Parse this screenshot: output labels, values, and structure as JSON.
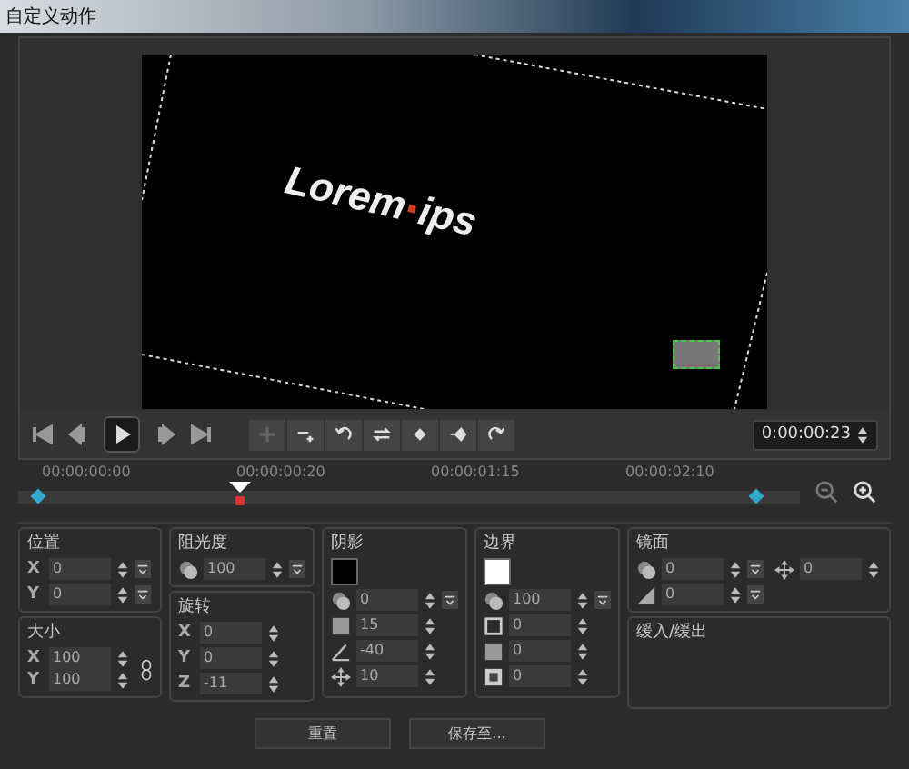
{
  "window": {
    "title": "自定义动作"
  },
  "preview": {
    "word_1": "Lorem",
    "word_2": "ips"
  },
  "transport": {
    "time": "0:00:00:23"
  },
  "timeline": {
    "labels": [
      "00:00:00:00",
      "00:00:00:20",
      "00:00:01:15",
      "00:00:02:10"
    ],
    "playhead": {
      "level": 0.29
    }
  },
  "groups": [
    {
      "title": "位置",
      "fields": [
        {
          "label": "X",
          "value": "0",
          "menu": true
        },
        {
          "label": "Y",
          "value": "0",
          "menu": true
        }
      ]
    },
    {
      "title": "大小",
      "linked": true,
      "fields": [
        {
          "label": "X",
          "value": "100",
          "menu": false
        },
        {
          "label": "Y",
          "value": "100",
          "menu": false
        }
      ]
    },
    {
      "title": "阻光度",
      "fields": [
        {
          "kind": "opacity",
          "value": "100",
          "menu": true
        }
      ]
    },
    {
      "title": "旋转",
      "fields": [
        {
          "label": "X",
          "value": "0",
          "menu": false
        },
        {
          "label": "Y",
          "value": "0",
          "menu": false
        },
        {
          "label": "Z",
          "value": "-11",
          "menu": false
        }
      ]
    },
    {
      "title": "阴影",
      "color": "#000000",
      "fields": [
        {
          "kind": "opacity",
          "value": "0",
          "menu": true
        },
        {
          "kind": "blur",
          "value": "15",
          "menu": false
        },
        {
          "kind": "angle",
          "value": "-40",
          "menu": false
        },
        {
          "kind": "move",
          "value": "10",
          "menu": false
        }
      ]
    },
    {
      "title": "边界",
      "color": "#ffffff",
      "fields": [
        {
          "kind": "opacity",
          "value": "100",
          "menu": true
        },
        {
          "kind": "outline",
          "value": "0",
          "menu": false
        },
        {
          "kind": "blur",
          "value": "0",
          "menu": false
        },
        {
          "kind": "inner",
          "value": "0",
          "menu": false
        }
      ]
    },
    {
      "title": "镜面",
      "fields": [
        {
          "kind": "opacity",
          "value": "0",
          "menu": true
        },
        {
          "kind": "move",
          "value": "0",
          "menu": false
        },
        {
          "kind": "fade",
          "value": "0",
          "menu": true
        }
      ]
    },
    {
      "title": "缓入/缓出"
    }
  ],
  "buttons": [
    "重置",
    "保存至..."
  ]
}
